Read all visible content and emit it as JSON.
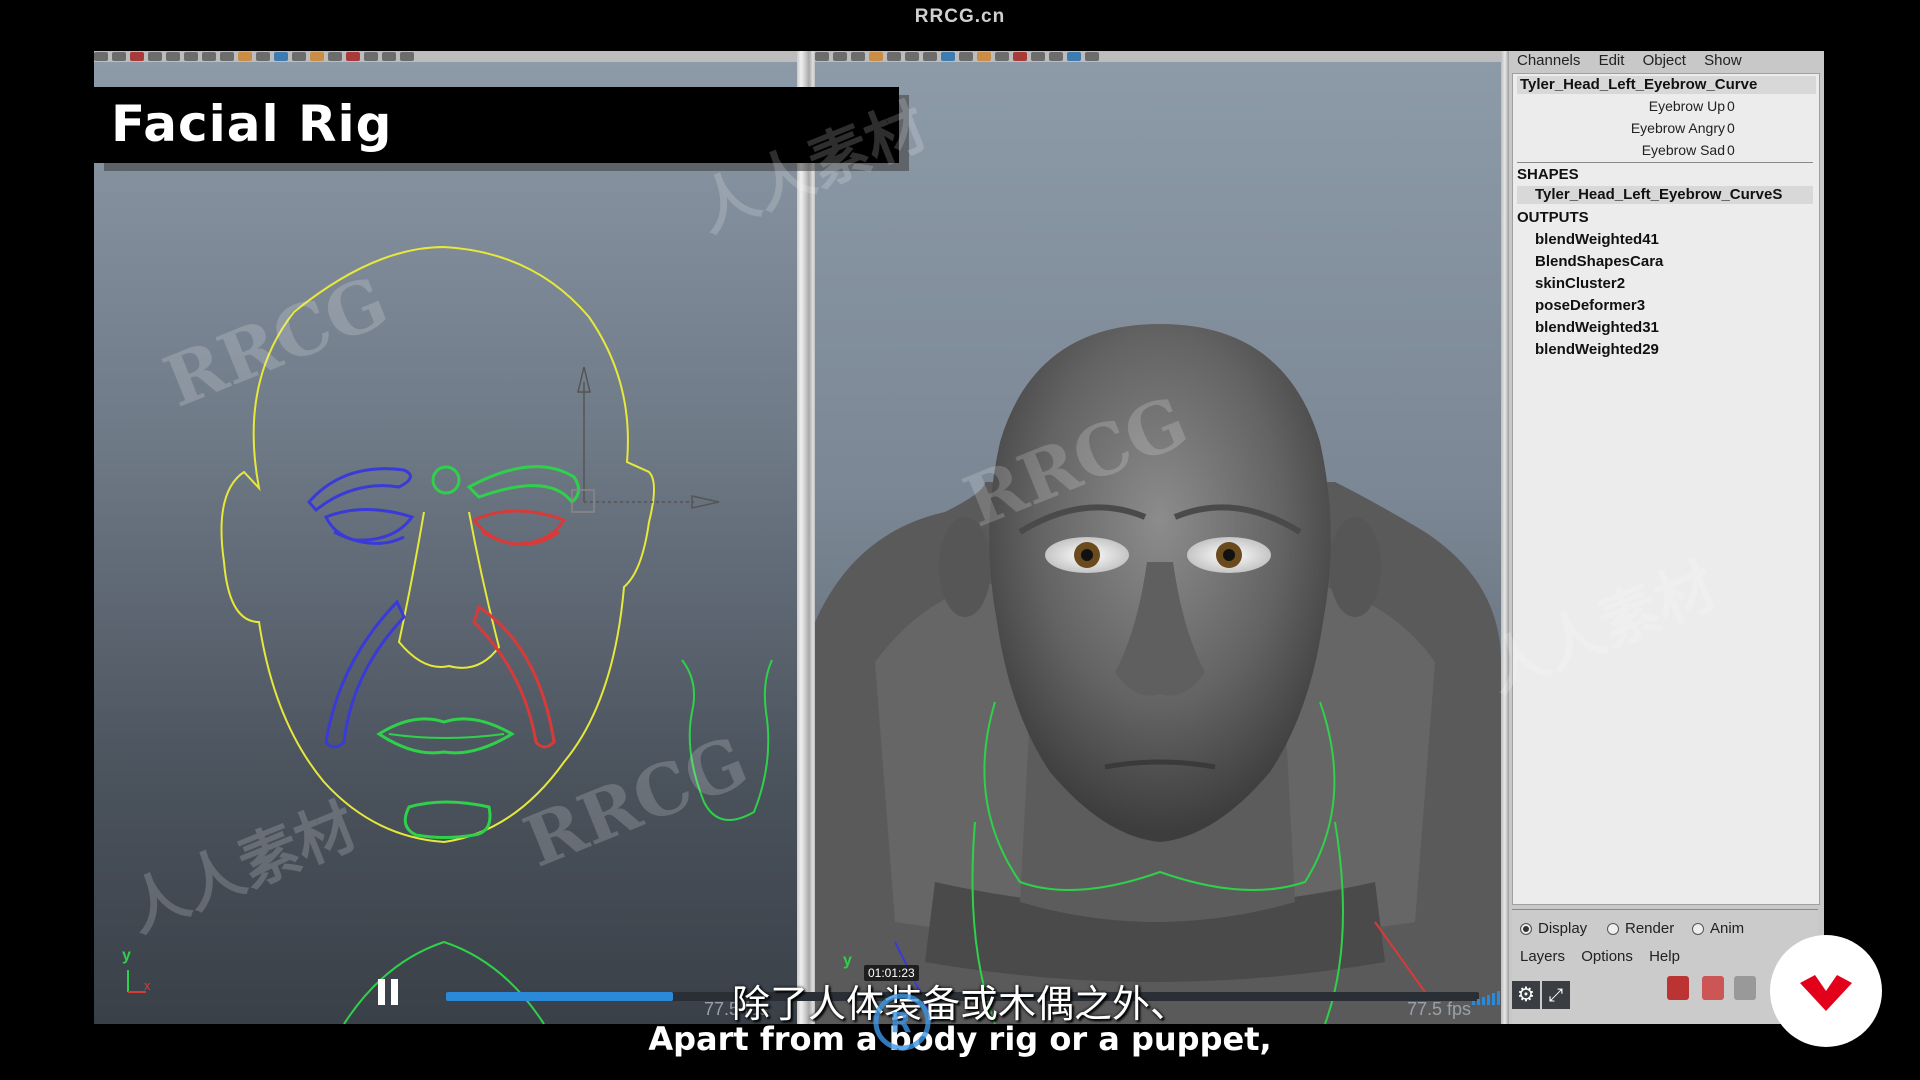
{
  "site_watermark": "RRCG.cn",
  "overlay_title": "Facial Rig",
  "channel_box": {
    "menu": [
      "Channels",
      "Edit",
      "Object",
      "Show"
    ],
    "object_name": "Tyler_Head_Left_Eyebrow_Curve",
    "attributes": [
      {
        "name": "Eyebrow Up",
        "value": "0"
      },
      {
        "name": "Eyebrow Angry",
        "value": "0"
      },
      {
        "name": "Eyebrow Sad",
        "value": "0"
      }
    ],
    "shapes_header": "SHAPES",
    "shape_name": "Tyler_Head_Left_Eyebrow_CurveS",
    "outputs_header": "OUTPUTS",
    "outputs": [
      "blendWeighted41",
      "BlendShapesCara",
      "skinCluster2",
      "poseDeformer3",
      "blendWeighted31",
      "blendWeighted29"
    ]
  },
  "layer_editor": {
    "modes": [
      {
        "label": "Display",
        "selected": true
      },
      {
        "label": "Render",
        "selected": false
      },
      {
        "label": "Anim",
        "selected": false
      }
    ],
    "menu": [
      "Layers",
      "Options",
      "Help"
    ]
  },
  "player": {
    "time_badge": "01:01:23",
    "progress": 0.22,
    "fps_left": "77.5 fps",
    "fps_right": "77.5 fps"
  },
  "subtitles": {
    "zh": "除了人体装备或木偶之外、",
    "en": "Apart from a body rig or a puppet,"
  },
  "axis": {
    "y": "y",
    "x": "x"
  },
  "watermarks": [
    "RRCG",
    "人人素材",
    "RRCG",
    "人人素材",
    "RRCG",
    "人人素材"
  ],
  "colors": {
    "face_outline": "#e6e83a",
    "left_controls": "#3a3ad8",
    "right_controls": "#d83a3a",
    "mouth_controls": "#2fd04a",
    "accent_red": "#e3001b",
    "progress_blue": "#2a8ad7"
  }
}
